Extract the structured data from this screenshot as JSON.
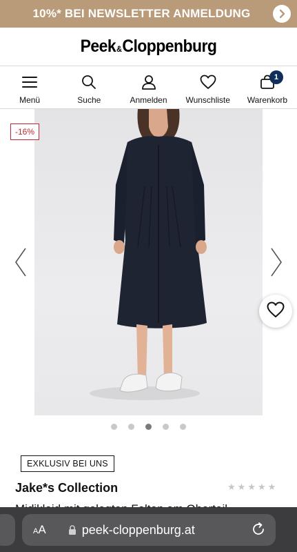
{
  "promo": {
    "text": "10%* BEI NEWSLETTER ANMELDUNG",
    "arrow_icon": "chevron-right-icon"
  },
  "logo": {
    "part1": "Peek",
    "amp": "&",
    "part2": "Cloppenburg"
  },
  "nav": {
    "items": [
      {
        "label": "Menü",
        "icon": "hamburger-menu-icon"
      },
      {
        "label": "Suche",
        "icon": "search-icon"
      },
      {
        "label": "Anmelden",
        "icon": "user-icon"
      },
      {
        "label": "Wunschliste",
        "icon": "heart-icon"
      },
      {
        "label": "Warenkorb",
        "icon": "shopping-bag-icon"
      }
    ],
    "cart_count": "1"
  },
  "product": {
    "discount_badge": "-16%",
    "image_count": 5,
    "active_image_index": 2,
    "exclusive_label": "EXKLUSIV BEI UNS",
    "brand": "Jake*s Collection",
    "rating_stars": 0,
    "rating_max": 5,
    "description_partial": "Midikleid mit gelegten Falten am Oberteil"
  },
  "browser": {
    "text_size_label_small": "A",
    "text_size_label_large": "A",
    "url": "peek-cloppenburg.at",
    "lock_icon": "lock-icon",
    "reload_icon": "reload-icon"
  },
  "colors": {
    "promo_bg": "#b99a79",
    "cart_badge": "#0f2f5a",
    "discount": "#c0282d"
  }
}
